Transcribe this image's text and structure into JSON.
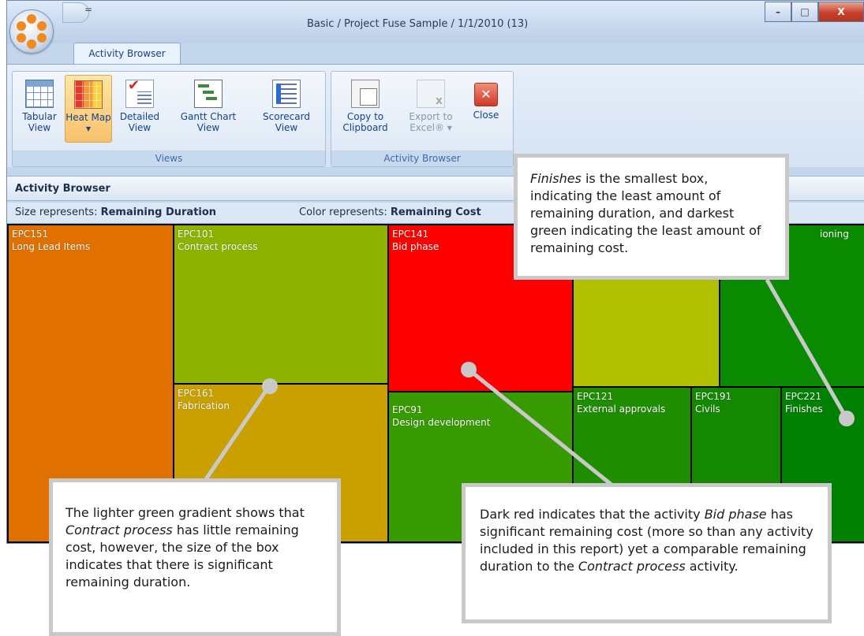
{
  "window": {
    "title": "Basic / Project Fuse Sample / 1/1/2010 (13)",
    "buttons": {
      "minimize": "–",
      "maximize": "□",
      "close": "X"
    },
    "qat_arrow": "="
  },
  "ribbon": {
    "tab": "Activity Browser",
    "groups": {
      "views": {
        "label": "Views",
        "buttons": {
          "tabular": "Tabular View",
          "heat_map": "Heat Map ▾",
          "detailed": "Detailed View",
          "gantt": "Gantt Chart View",
          "scorecard": "Scorecard View"
        }
      },
      "activity_browser": {
        "label": "Activity Browser",
        "buttons": {
          "copy": "Copy to Clipboard",
          "export": "Export to Excel® ▾",
          "close": "Close"
        }
      }
    }
  },
  "panel": {
    "title": "Activity Browser",
    "size_prefix": "Size represents: ",
    "size_value": "Remaining Duration",
    "color_prefix": "Color represents: ",
    "color_value": "Remaining Cost"
  },
  "treemap": {
    "cells": [
      {
        "code": "EPC151",
        "name": "Long Lead Items",
        "color": "#e07000"
      },
      {
        "code": "EPC101",
        "name": "Contract process",
        "color": "#8db300"
      },
      {
        "code": "EPC161",
        "name": "Fabrication",
        "color": "#c9a000"
      },
      {
        "code": "EPC141",
        "name": "Bid phase",
        "color": "#ff0000"
      },
      {
        "code": "EPC91",
        "name": "Design development",
        "color": "#369a00"
      },
      {
        "code": "",
        "name": "",
        "color": "#b1c000"
      },
      {
        "code": "",
        "name": "ioning",
        "color": "#0a8a00"
      },
      {
        "code": "EPC121",
        "name": "External approvals",
        "color": "#1e8d00"
      },
      {
        "code": "EPC191",
        "name": "Civils",
        "color": "#138800"
      },
      {
        "code": "EPC221",
        "name": "Finishes",
        "color": "#008000"
      }
    ]
  },
  "callouts": {
    "finishes": "<i>Finishes</i> is the smallest box, indicating the least amount of remaining duration, and darkest green indicating the least amount of remaining cost.",
    "contract": "The lighter green gradient shows that <i>Contract process</i> has little remaining cost, however, the size of the box indicates that there is significant remaining duration.",
    "bid": "Dark red indicates that  the activity <i>Bid phase</i> has significant remaining cost (more so than any activity included in this report) yet a comparable remaining duration to the <i>Contract process</i> activity."
  }
}
